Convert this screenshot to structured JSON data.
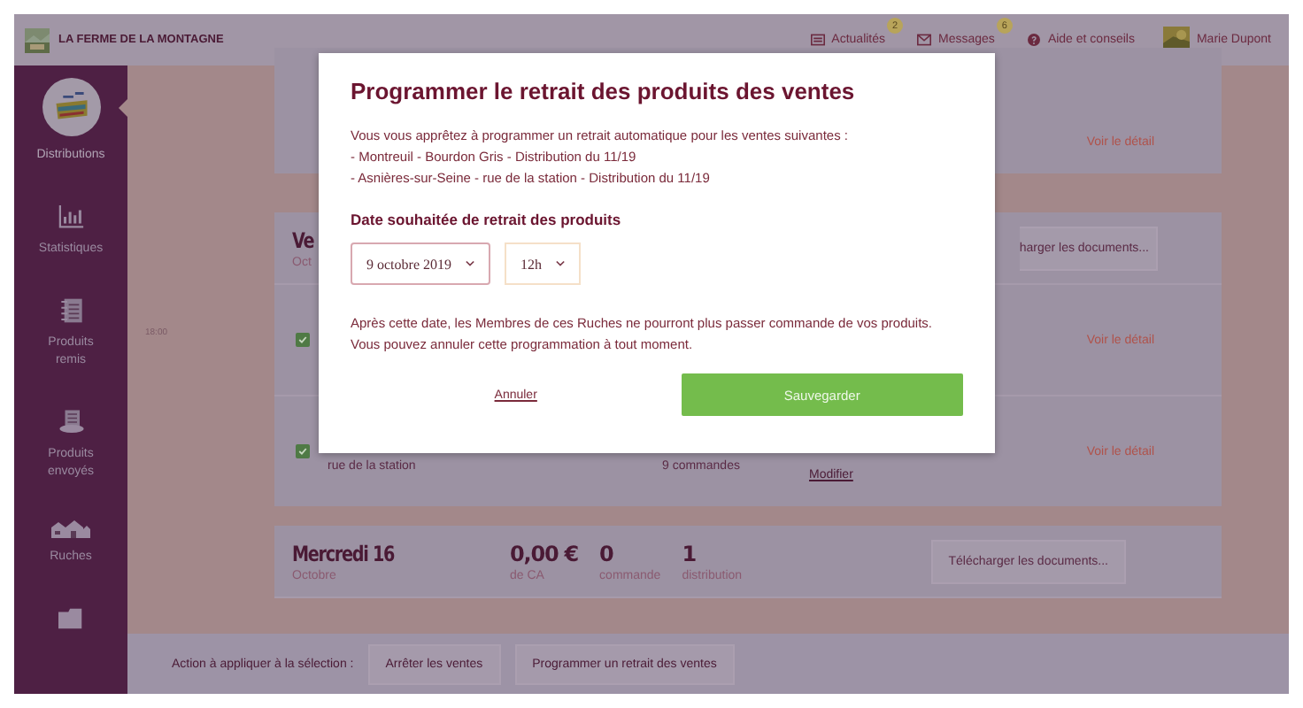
{
  "header": {
    "brand": "LA FERME DE LA MONTAGNE",
    "links": [
      {
        "kind": "news",
        "label": "Actualités",
        "badge": "2"
      },
      {
        "kind": "mail",
        "label": "Messages",
        "badge": "6"
      },
      {
        "kind": "help",
        "label": "Aide et conseils"
      }
    ],
    "user": "Marie Dupont"
  },
  "sidebar": {
    "items": [
      {
        "kind": "basket",
        "label": "Distributions",
        "selected": true
      },
      {
        "kind": "chart",
        "label": "Statistiques",
        "selected": false
      },
      {
        "kind": "notebook",
        "label": "Produits remis",
        "selected": false
      },
      {
        "kind": "notebook-stand",
        "label": "Produits envoyés",
        "selected": false
      },
      {
        "kind": "houses",
        "label": "Ruches",
        "selected": false
      },
      {
        "kind": "folder",
        "selected": false
      }
    ]
  },
  "cards": [
    {
      "kind": "partial",
      "link": "Voir le détail"
    },
    {
      "kind": "day",
      "day": "Ve",
      "month": "Oct",
      "download": "harger les documents...",
      "sales": [
        {
          "time": "18:00",
          "checked": true,
          "link": "Voir le détail"
        },
        {
          "checked": true,
          "place": "rue de la station",
          "orders": "9 commandes",
          "action": "Modifier",
          "link": "Voir le détail"
        }
      ]
    },
    {
      "kind": "day",
      "day": "Mercredi 16",
      "month": "Octobre",
      "stats": [
        {
          "value": "0,00 €",
          "label": "de CA"
        },
        {
          "value": "0",
          "label": "commande"
        },
        {
          "value": "1",
          "label": "distribution"
        }
      ],
      "download": "Télécharger les documents..."
    }
  ],
  "selection_bar": {
    "label": "Action à appliquer à la sélection :",
    "buttons": [
      "Arrêter les ventes",
      "Programmer un retrait des ventes"
    ]
  },
  "modal": {
    "title": "Programmer le retrait des produits des ventes",
    "intro": "Vous vous apprêtez à programmer un retrait automatique pour les ventes suivantes :",
    "sales": [
      "- Montreuil - Bourdon Gris - Distribution du 11/19",
      "- Asnières-sur-Seine - rue de la station - Distribution du 11/19"
    ],
    "date_heading": "Date souhaitée de retrait des produits",
    "date_select": "9 octobre 2019",
    "hour_select": "12h",
    "notice": "Après cette date, les Membres de ces Ruches ne pourront plus passer commande de vos produits. Vous pouvez annuler cette programmation à tout moment.",
    "cancel": "Annuler",
    "save": "Sauvegarder"
  }
}
